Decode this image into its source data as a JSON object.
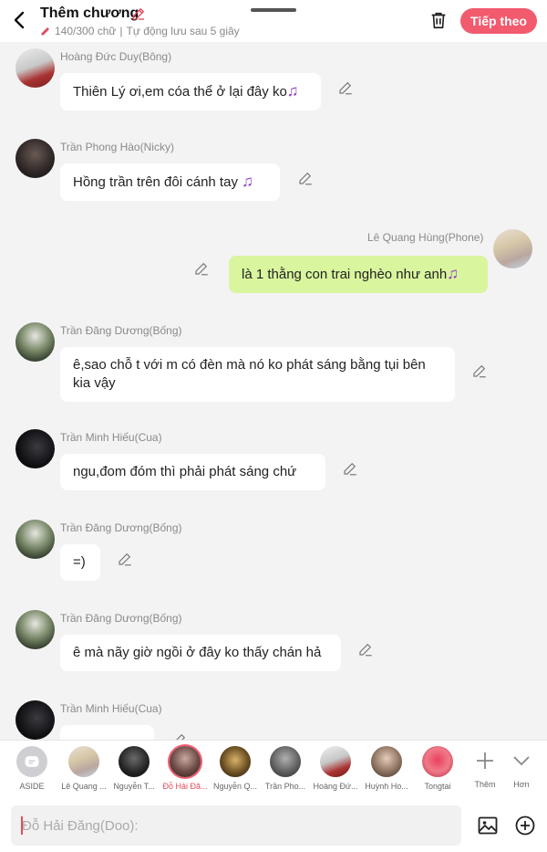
{
  "header": {
    "title": "Thêm chương",
    "word_count": "140/300 chữ",
    "separator": "|",
    "autosave": "Tự động lưu sau 5 giây",
    "next_label": "Tiếp theo",
    "accent": "#f25a6e"
  },
  "messages": [
    {
      "sender": "Hoàng Đức Duy(Bông)",
      "text": "Thiên Lý ơi,em cóa thể ở lại đây ko",
      "side": "left",
      "suffix_icon": "music-note-icon"
    },
    {
      "sender": "Trần Phong Hào(Nicky)",
      "text": "Hồng trần trên đôi cánh tay ",
      "side": "left",
      "suffix_icon": "music-note-icon"
    },
    {
      "sender": "Lê Quang Hùng(Phone)",
      "text": "là 1 thằng con trai nghèo như anh",
      "side": "right",
      "suffix_icon": "music-note-icon"
    },
    {
      "sender": "Trần Đăng Dương(Bống)",
      "text": "ê,sao chỗ t với m có đèn mà nó ko phát sáng bằng tụi bên kia vậy",
      "side": "left"
    },
    {
      "sender": "Trần Minh Hiếu(Cua)",
      "text": "ngu,đom đóm thì phải phát sáng chứ",
      "side": "left"
    },
    {
      "sender": "Trần Đăng Dương(Bống)",
      "text": "=)",
      "side": "left"
    },
    {
      "sender": "Trần Đăng Dương(Bống)",
      "text": "ê mà nãy giờ ngồi ở đây ko thấy chán hả",
      "side": "left"
    },
    {
      "sender": "Trần Minh Hiếu(Cua)",
      "text": "",
      "side": "left"
    }
  ],
  "characters": [
    {
      "name": "ASIDE",
      "icon": "aside-icon"
    },
    {
      "name": "Lê Quang ..."
    },
    {
      "name": "Nguyễn T..."
    },
    {
      "name": "Đỗ Hải Đă...",
      "selected": true
    },
    {
      "name": "Nguyễn Q..."
    },
    {
      "name": "Trần Pho..."
    },
    {
      "name": "Hoàng Đứ..."
    },
    {
      "name": "Huỳnh Ho..."
    },
    {
      "name": "Tongtai"
    }
  ],
  "tools": {
    "add_label": "Thêm",
    "more_label": "Hơn"
  },
  "input": {
    "placeholder": "Đỗ Hải Đăng(Doo):"
  }
}
